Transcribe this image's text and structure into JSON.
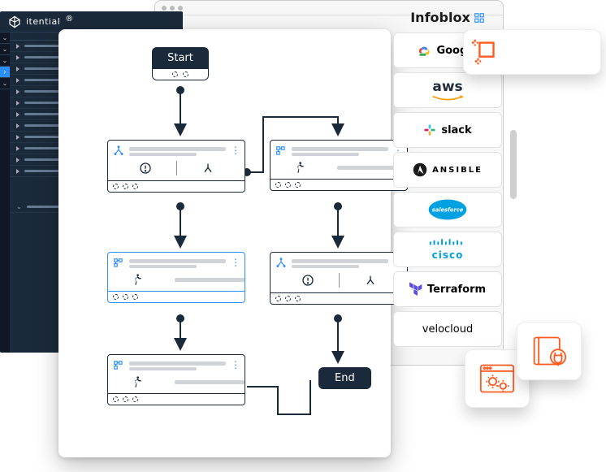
{
  "app": {
    "brand": "itential",
    "left_nav": {
      "chevrons": [
        "down",
        "down",
        "down",
        "right",
        "down"
      ],
      "active_index": 3
    },
    "menu_rows": 12
  },
  "workflow": {
    "start_label": "Start",
    "end_label": "End",
    "tasks": [
      {
        "id": "t1",
        "icon": "branch",
        "selected": false,
        "mid": "branch"
      },
      {
        "id": "t2",
        "icon": "grid",
        "selected": true,
        "mid": "run"
      },
      {
        "id": "t3",
        "icon": "grid",
        "selected": false,
        "mid": "run"
      },
      {
        "id": "t4",
        "icon": "grid",
        "selected": false,
        "mid": "run"
      },
      {
        "id": "t5",
        "icon": "branch",
        "selected": false,
        "mid": "branch"
      }
    ]
  },
  "integrations": {
    "first": "Infoblox",
    "items": [
      "Google",
      "aws",
      "slack",
      "ANSIBLE",
      "salesforce",
      "cisco",
      "Terraform",
      "velocloud"
    ]
  },
  "callout": {
    "icon": "crop-icon"
  },
  "adapters": [
    {
      "icon": "browser-gears-icon"
    },
    {
      "icon": "book-plug-icon"
    }
  ]
}
